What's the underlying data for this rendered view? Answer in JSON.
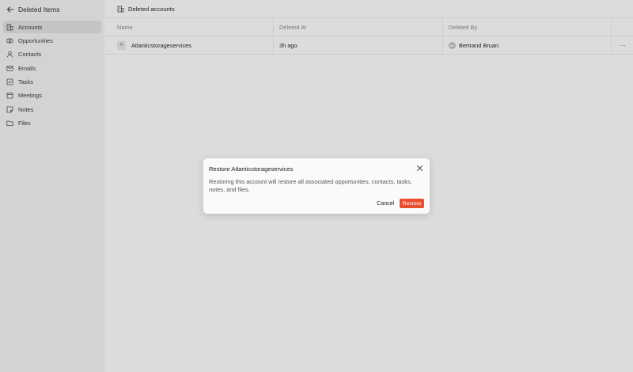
{
  "sidebar": {
    "header": {
      "title": "Deleted Items",
      "back_icon": "arrow-left-icon"
    },
    "items": [
      {
        "label": "Accounts",
        "icon": "building-icon",
        "active": true
      },
      {
        "label": "Opportunities",
        "icon": "opportunities-icon",
        "active": false
      },
      {
        "label": "Contacts",
        "icon": "user-icon",
        "active": false
      },
      {
        "label": "Emails",
        "icon": "mail-icon",
        "active": false
      },
      {
        "label": "Tasks",
        "icon": "checkbox-icon",
        "active": false
      },
      {
        "label": "Meetings",
        "icon": "calendar-icon",
        "active": false
      },
      {
        "label": "Notes",
        "icon": "note-icon",
        "active": false
      },
      {
        "label": "Files",
        "icon": "folder-icon",
        "active": false
      }
    ]
  },
  "main": {
    "title": "Deleted accounts",
    "table": {
      "columns": [
        "Name",
        "Deleted At",
        "Deleted By"
      ],
      "rows": [
        {
          "avatar": "A",
          "name": "Atlanticstorageservices",
          "deleted_at": "3h ago",
          "deleted_by": "Bertrand Bruan",
          "deleted_by_initials": "BB",
          "more": "···"
        }
      ]
    }
  },
  "modal": {
    "title": "Restore Atlanticstorageservices",
    "body": "Restoring this account will restore all associated opportunities, contacts, tasks, notes, and files.",
    "cancel_label": "Cancel",
    "restore_label": "Restore"
  },
  "colors": {
    "accent": "#e94e2f",
    "sidebar_bg": "#d3d3d3",
    "main_bg": "#dcdcdc"
  }
}
